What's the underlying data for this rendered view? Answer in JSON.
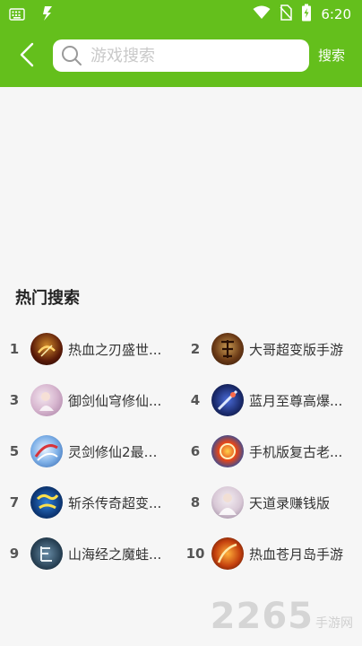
{
  "status_bar": {
    "time": "6:20",
    "icons": [
      "keyboard-icon",
      "lightning-icon",
      "wifi-icon",
      "no-sim-icon",
      "battery-icon"
    ]
  },
  "header": {
    "search_placeholder": "游戏搜索",
    "search_button": "搜索"
  },
  "hot_search": {
    "title": "热门搜索",
    "items": [
      {
        "rank": "1",
        "name": "热血之刃盛世..."
      },
      {
        "rank": "2",
        "name": "大哥超变版手游"
      },
      {
        "rank": "3",
        "name": "御剑仙穹修仙..."
      },
      {
        "rank": "4",
        "name": "蓝月至尊高爆..."
      },
      {
        "rank": "5",
        "name": "灵剑修仙2最新..."
      },
      {
        "rank": "6",
        "name": "手机版复古老..."
      },
      {
        "rank": "7",
        "name": "斩杀传奇超变..."
      },
      {
        "rank": "8",
        "name": "天道录赚钱版"
      },
      {
        "rank": "9",
        "name": "山海经之魔蛙..."
      },
      {
        "rank": "10",
        "name": "热血苍月岛手游"
      }
    ]
  },
  "watermark": {
    "main": "2265",
    "sub": "手游网"
  },
  "colors": {
    "header_green": "#64bf1c",
    "background": "#f6f6f6"
  }
}
